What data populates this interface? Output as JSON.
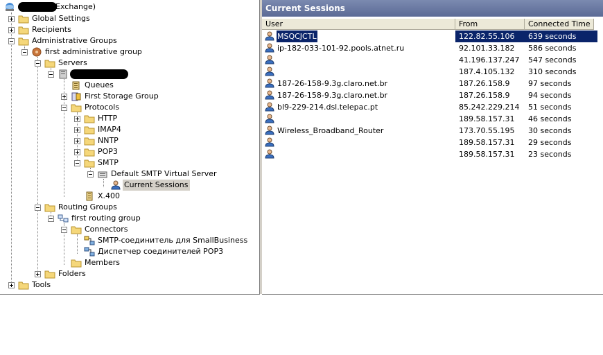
{
  "tree": {
    "root_label": "Exchange)",
    "global_settings": "Global Settings",
    "recipients": "Recipients",
    "admin_groups": "Administrative Groups",
    "first_admin_group": "first administrative group",
    "servers": "Servers",
    "queues": "Queues",
    "first_storage_group": "First Storage Group",
    "protocols": "Protocols",
    "http": "HTTP",
    "imap4": "IMAP4",
    "nntp": "NNTP",
    "pop3": "POP3",
    "smtp": "SMTP",
    "default_smtp": "Default SMTP Virtual Server",
    "current_sessions": "Current Sessions",
    "x400": "X.400",
    "routing_groups": "Routing Groups",
    "first_routing_group": "first routing group",
    "connectors": "Connectors",
    "smtp_connector": "SMTP-соединитель для SmallBusiness",
    "pop3_dispatcher": "Диспетчер соединителей POP3",
    "members": "Members",
    "folders": "Folders",
    "tools": "Tools"
  },
  "panel": {
    "title": "Current Sessions",
    "columns": {
      "user": "User",
      "from": "From",
      "time": "Connected Time"
    },
    "rows": [
      {
        "user": "MSQCJCTL",
        "from": "122.82.55.106",
        "time": "639 seconds"
      },
      {
        "user": "ip-182-033-101-92.pools.atnet.ru",
        "from": "92.101.33.182",
        "time": "586 seconds"
      },
      {
        "user": "",
        "from": "41.196.137.247",
        "time": "547 seconds"
      },
      {
        "user": "",
        "from": "187.4.105.132",
        "time": "310 seconds"
      },
      {
        "user": "187-26-158-9.3g.claro.net.br",
        "from": "187.26.158.9",
        "time": "97 seconds"
      },
      {
        "user": "187-26-158-9.3g.claro.net.br",
        "from": "187.26.158.9",
        "time": "94 seconds"
      },
      {
        "user": "bl9-229-214.dsl.telepac.pt",
        "from": "85.242.229.214",
        "time": "51 seconds"
      },
      {
        "user": "",
        "from": "189.58.157.31",
        "time": "46 seconds"
      },
      {
        "user": "Wireless_Broadband_Router",
        "from": "173.70.55.195",
        "time": "30 seconds"
      },
      {
        "user": "",
        "from": "189.58.157.31",
        "time": "29 seconds"
      },
      {
        "user": "",
        "from": "189.58.157.31",
        "time": "23 seconds"
      }
    ]
  },
  "colors": {
    "folder": "#f5d77a",
    "selection": "#0a246a",
    "title_bar": "#6a79a3"
  }
}
